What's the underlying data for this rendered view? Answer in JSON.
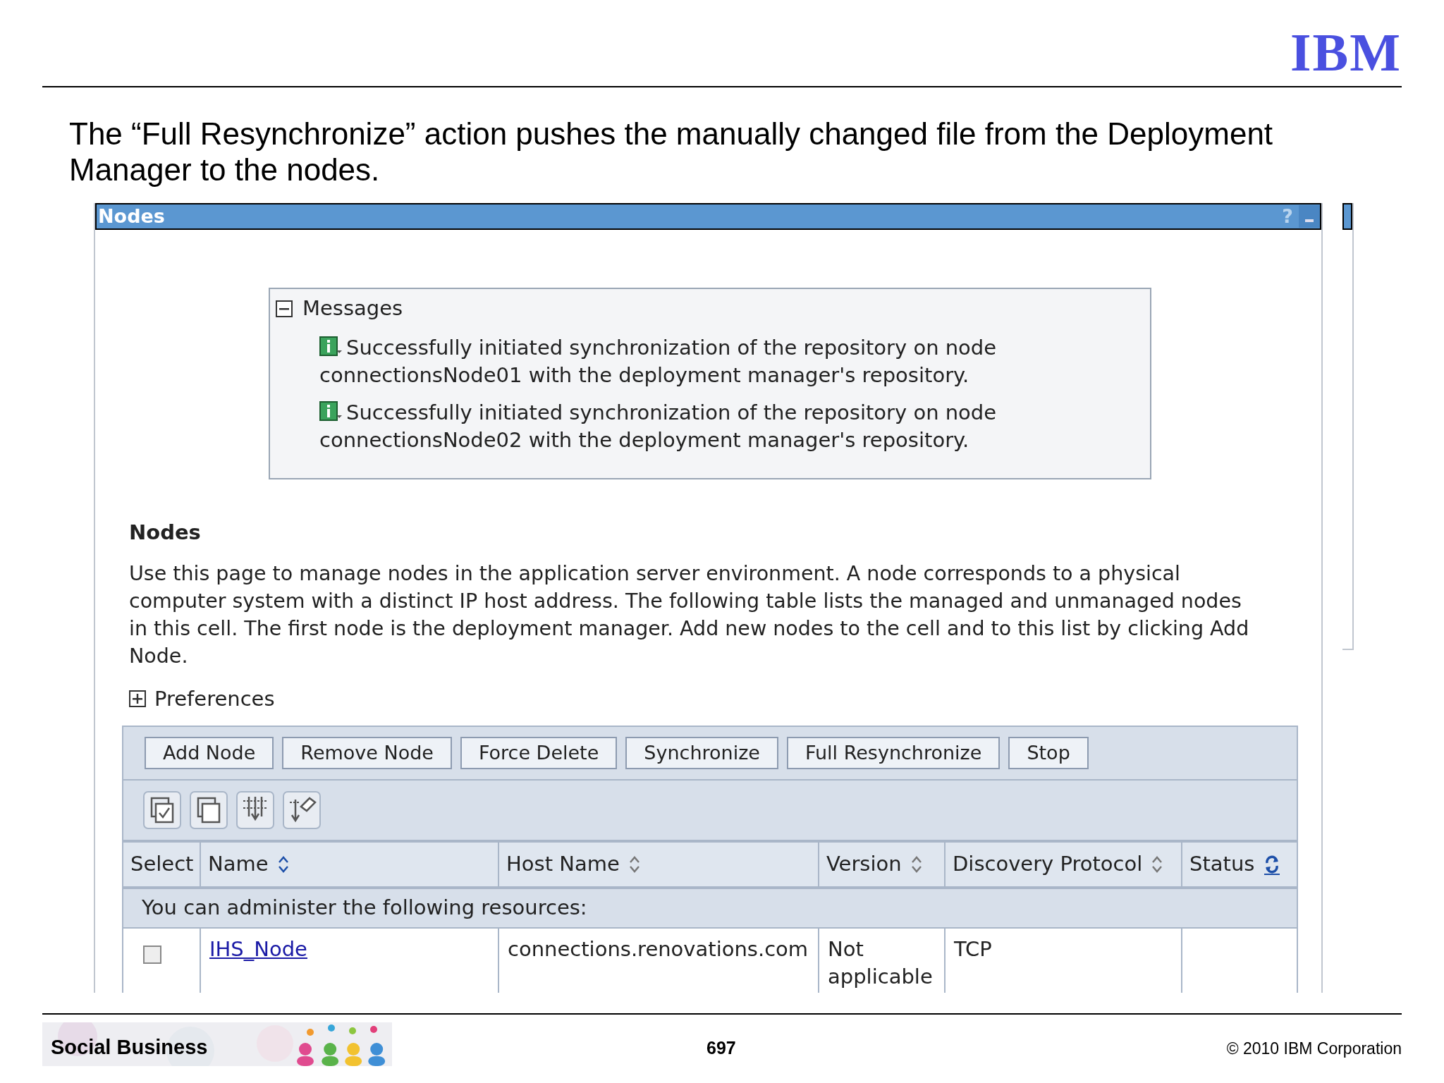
{
  "slide": {
    "logo": "IBM",
    "title": "The “Full Resynchronize” action pushes the manually changed file from the Deployment Manager to the nodes."
  },
  "window": {
    "title": "Nodes",
    "help": "?"
  },
  "messages": {
    "title": "Messages",
    "expanded": true,
    "items": [
      {
        "text": "Successfully initiated synchronization of the repository on node connectionsNode01 with the deployment manager's repository."
      },
      {
        "text": "Successfully initiated synchronization of the repository on node connectionsNode02 with the deployment manager's repository."
      }
    ]
  },
  "section": {
    "heading": "Nodes",
    "description": "Use this page to manage nodes in the application server environment. A node corresponds to a physical computer system with a distinct IP host address. The following table lists the managed and unmanaged nodes in this cell. The first node is the deployment manager. Add new nodes to the cell and to this list by clicking Add Node."
  },
  "preferences": {
    "label": "Preferences",
    "expanded": false
  },
  "buttons": [
    "Add Node",
    "Remove Node",
    "Force Delete",
    "Synchronize",
    "Full Resynchronize",
    "Stop"
  ],
  "table": {
    "columns": [
      {
        "label": "Select",
        "kind": "plain"
      },
      {
        "label": "Name",
        "kind": "sort",
        "sorted": true
      },
      {
        "label": "Host Name",
        "kind": "sort",
        "sorted": false
      },
      {
        "label": "Version",
        "kind": "sort",
        "sorted": false
      },
      {
        "label": "Discovery Protocol",
        "kind": "sort",
        "sorted": false
      },
      {
        "label": "Status",
        "kind": "refresh"
      }
    ],
    "group_row": "You can administer the following resources:",
    "rows": [
      {
        "checked": false,
        "name": "IHS_Node",
        "host": "connections.renovations.com",
        "version": "Not applicable",
        "protocol": "TCP"
      }
    ]
  },
  "footer": {
    "brand": "Social Business",
    "page": "697",
    "copyright": "© 2010 IBM Corporation"
  }
}
